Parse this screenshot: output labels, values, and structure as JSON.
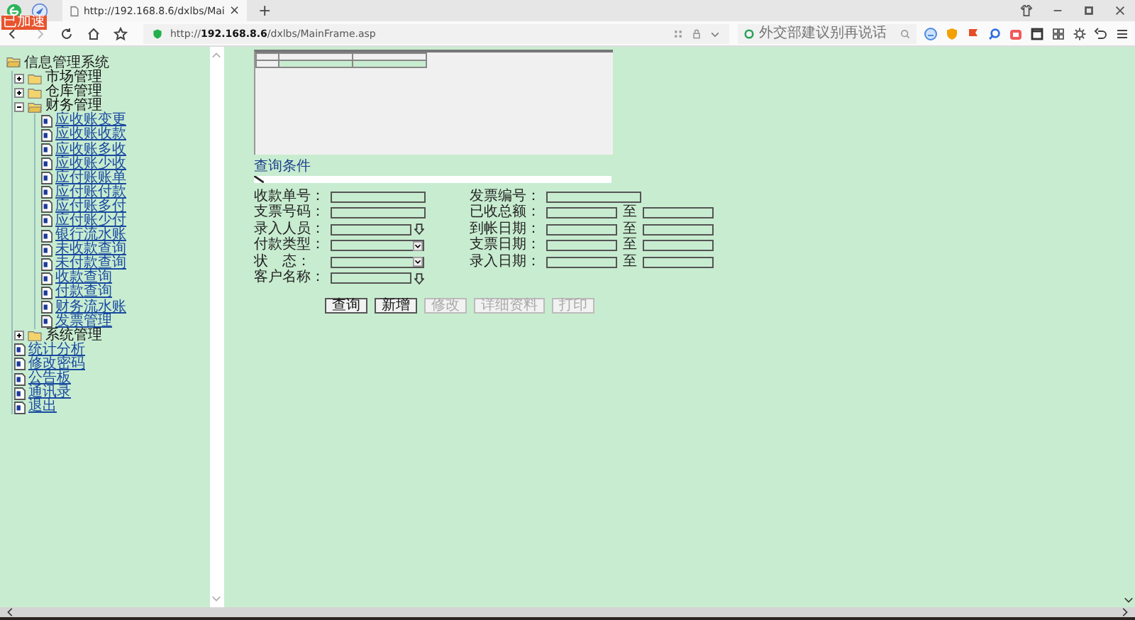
{
  "browser": {
    "badge": "已加速",
    "tab_title": "http://192.168.8.6/dxlbs/Mai",
    "tab_close": "×",
    "new_tab": "+",
    "url_prefix": "http://",
    "url_host": "192.168.8.6",
    "url_path": "/dxlbs/MainFrame.asp",
    "search_placeholder": "外交部建议别再说话"
  },
  "tree": {
    "title": "信息管理系统",
    "items": [
      {
        "label": "市场管理",
        "kind": "folder",
        "expanded": false
      },
      {
        "label": "仓库管理",
        "kind": "folder",
        "expanded": false
      },
      {
        "label": "财务管理",
        "kind": "folder",
        "expanded": true,
        "children": [
          {
            "label": "应收账变更",
            "kind": "page"
          },
          {
            "label": "应收账收款",
            "kind": "page"
          },
          {
            "label": "应收账多收",
            "kind": "page"
          },
          {
            "label": "应收账少收",
            "kind": "page"
          },
          {
            "label": "应付账账单",
            "kind": "page"
          },
          {
            "label": "应付账付款",
            "kind": "page"
          },
          {
            "label": "应付账多付",
            "kind": "page"
          },
          {
            "label": "应付账少付",
            "kind": "page"
          },
          {
            "label": "银行流水账",
            "kind": "page"
          },
          {
            "label": "未收款查询",
            "kind": "page"
          },
          {
            "label": "未付款查询",
            "kind": "page"
          },
          {
            "label": "收款查询",
            "kind": "page"
          },
          {
            "label": "付款查询",
            "kind": "page"
          },
          {
            "label": "财务流水账",
            "kind": "page"
          },
          {
            "label": "发票管理",
            "kind": "page"
          }
        ]
      },
      {
        "label": "系统管理",
        "kind": "folder",
        "expanded": false
      },
      {
        "label": "统计分析",
        "kind": "page"
      },
      {
        "label": "修改密码",
        "kind": "page"
      },
      {
        "label": "公告板",
        "kind": "page"
      },
      {
        "label": "通讯录",
        "kind": "page"
      },
      {
        "label": "退出",
        "kind": "page"
      }
    ]
  },
  "query": {
    "title": "查询条件"
  },
  "form": {
    "rows": [
      {
        "fields": [
          {
            "label": "收款单号：",
            "kind": "text"
          },
          {
            "label": "发票编号：",
            "kind": "text"
          }
        ]
      },
      {
        "fields": [
          {
            "label": "支票号码：",
            "kind": "text"
          },
          {
            "label": "已收总额：",
            "kind": "range",
            "separator": "至"
          }
        ]
      },
      {
        "fields": [
          {
            "label": "录入人员：",
            "kind": "lookup"
          },
          {
            "label": "到帐日期：",
            "kind": "range",
            "separator": "至"
          }
        ]
      },
      {
        "fields": [
          {
            "label": "付款类型：",
            "kind": "select"
          },
          {
            "label": "支票日期：",
            "kind": "range",
            "separator": "至"
          }
        ]
      },
      {
        "fields": [
          {
            "label": "状　态：",
            "kind": "select"
          },
          {
            "label": "录入日期：",
            "kind": "range",
            "separator": "至"
          }
        ]
      },
      {
        "fields": [
          {
            "label": "客户名称：",
            "kind": "lookup"
          }
        ]
      }
    ]
  },
  "buttons": [
    {
      "label": "查询",
      "disabled": false
    },
    {
      "label": "新增",
      "disabled": false
    },
    {
      "label": "修改",
      "disabled": true
    },
    {
      "label": "详细资料",
      "disabled": true
    },
    {
      "label": "打印",
      "disabled": true
    }
  ]
}
